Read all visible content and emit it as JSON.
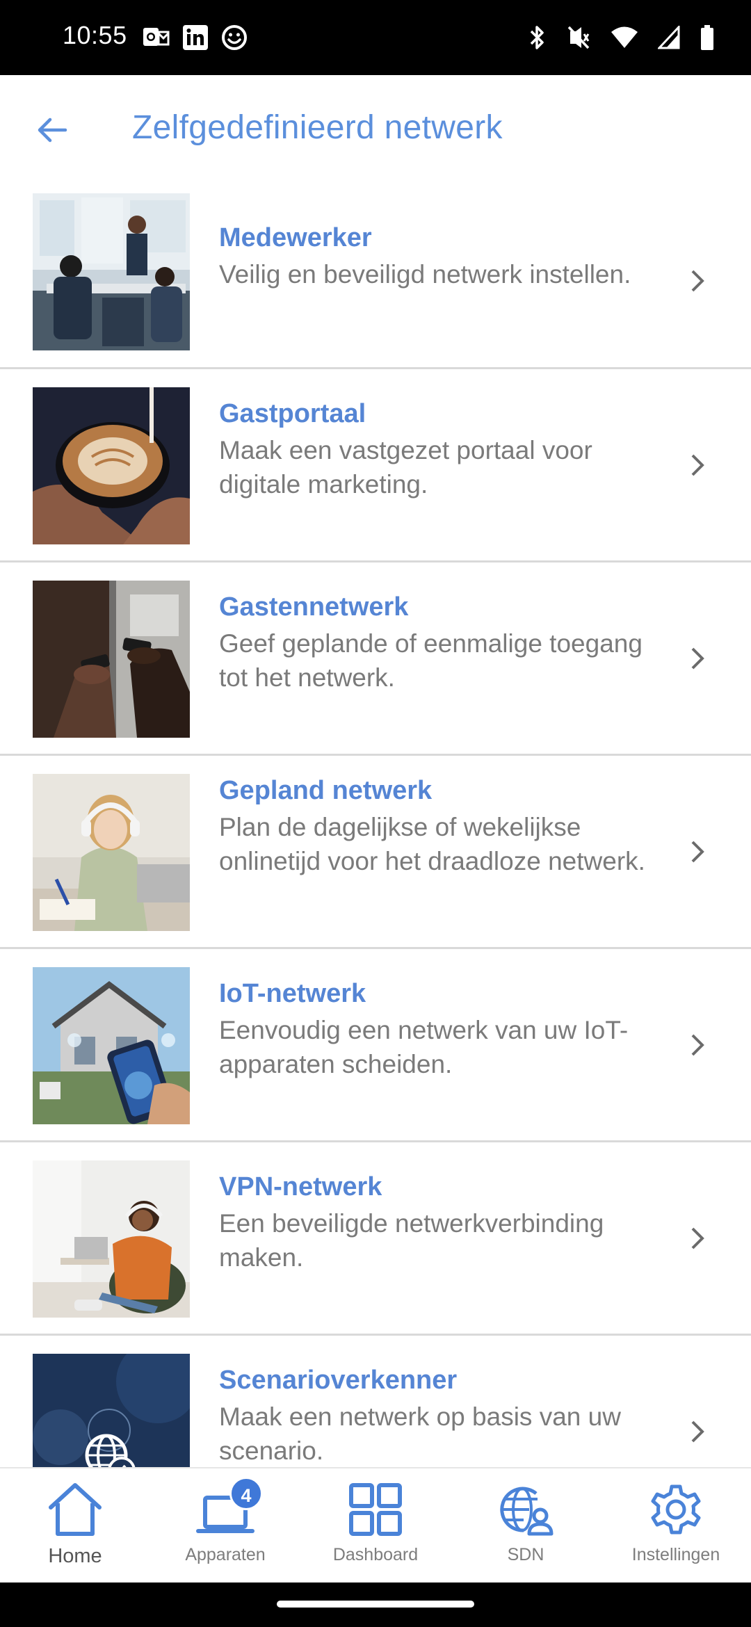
{
  "status_bar": {
    "time": "10:55",
    "left_icons": [
      "outlook-icon",
      "linkedin-icon",
      "smiley-icon"
    ],
    "right_icons": [
      "bluetooth-icon",
      "vibrate-off-icon",
      "wifi-icon",
      "signal-icon",
      "battery-icon"
    ]
  },
  "header": {
    "title": "Zelfgedefinieerd netwerk",
    "back_icon": "arrow-left-icon"
  },
  "colors": {
    "accent": "#5b8fdc",
    "title_blue": "#5585d4",
    "desc_gray": "#7a7a7a",
    "divider": "#d9d9d9"
  },
  "items": [
    {
      "title": "Medewerker",
      "description": "Veilig en beveiligd netwerk instellen."
    },
    {
      "title": "Gastportaal",
      "description": "Maak een vastgezet portaal voor digitale marketing."
    },
    {
      "title": "Gastennetwerk",
      "description": "Geef geplande of eenmalige toegang tot het netwerk."
    },
    {
      "title": "Gepland netwerk",
      "description": "Plan de dagelijkse of wekelijkse onlinetijd voor het draadloze netwerk."
    },
    {
      "title": "IoT-netwerk",
      "description": "Eenvoudig een netwerk van uw IoT-apparaten scheiden."
    },
    {
      "title": "VPN-netwerk",
      "description": "Een beveiligde netwerkverbinding maken."
    },
    {
      "title": "Scenarioverkenner",
      "description": "Maak een netwerk op basis van uw scenario."
    }
  ],
  "bottom_nav": {
    "items": [
      {
        "label": "Home",
        "icon": "home-icon"
      },
      {
        "label": "Apparaten",
        "icon": "devices-icon",
        "badge": "4"
      },
      {
        "label": "Dashboard",
        "icon": "dashboard-icon"
      },
      {
        "label": "SDN",
        "icon": "sdn-icon"
      },
      {
        "label": "Instellingen",
        "icon": "gear-icon"
      }
    ]
  }
}
